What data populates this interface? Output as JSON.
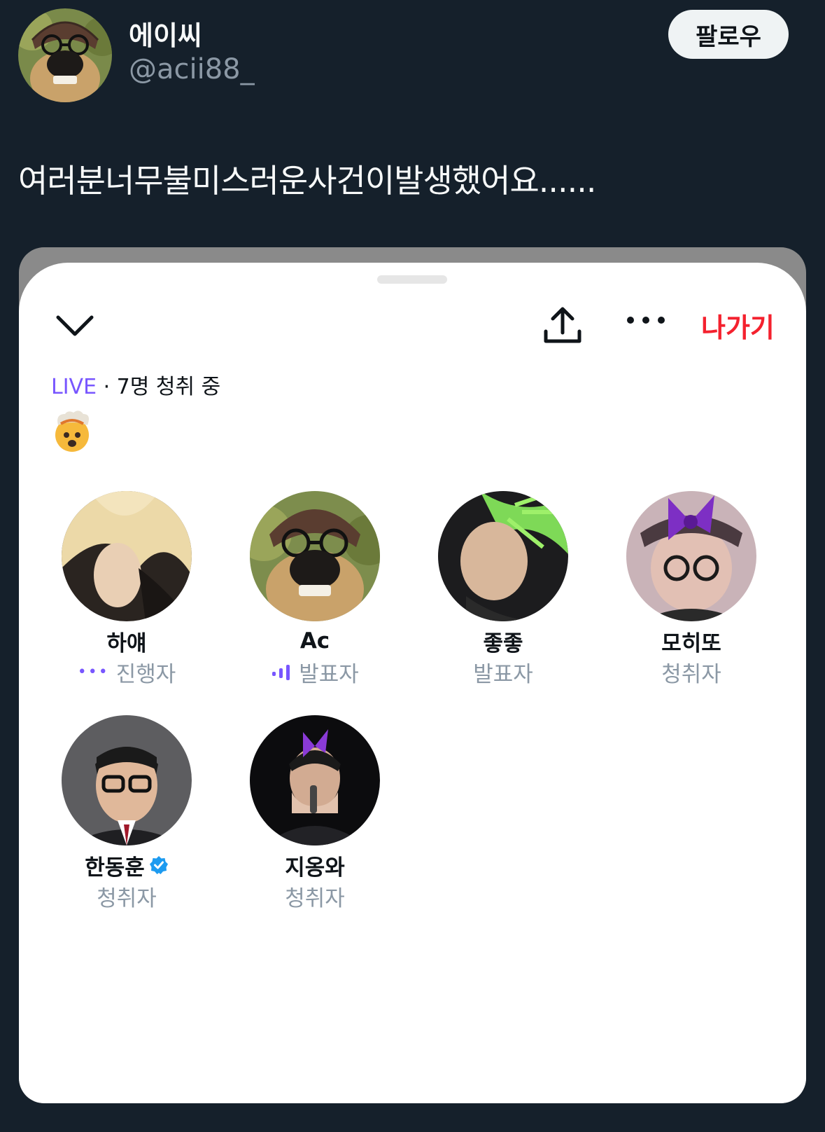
{
  "tweet": {
    "display_name": "에이씨",
    "handle": "@acii88_",
    "follow_label": "팔로우",
    "text": "여러분너무불미스러운사건이발생했어요......"
  },
  "space": {
    "leave_label": "나가기",
    "live_label": "LIVE",
    "listeners_text": " · 7명 청취 중",
    "reaction_emoji": "exploding-head",
    "participants": [
      {
        "name": "하얘",
        "role": "진행자",
        "indicator": "dots",
        "verified": false
      },
      {
        "name": "Ac",
        "role": "발표자",
        "indicator": "speaking-bars",
        "verified": false
      },
      {
        "name": "좋좋",
        "role": "발표자",
        "indicator": "none",
        "verified": false
      },
      {
        "name": "모히또",
        "role": "청취자",
        "indicator": "none",
        "verified": false
      },
      {
        "name": "한동훈",
        "role": "청취자",
        "indicator": "none",
        "verified": true
      },
      {
        "name": "지옹와",
        "role": "청취자",
        "indicator": "none",
        "verified": false
      }
    ]
  },
  "colors": {
    "background": "#15202b",
    "accent_purple": "#7856ff",
    "leave_red": "#f4212e",
    "verified_blue": "#1d9bf0"
  }
}
